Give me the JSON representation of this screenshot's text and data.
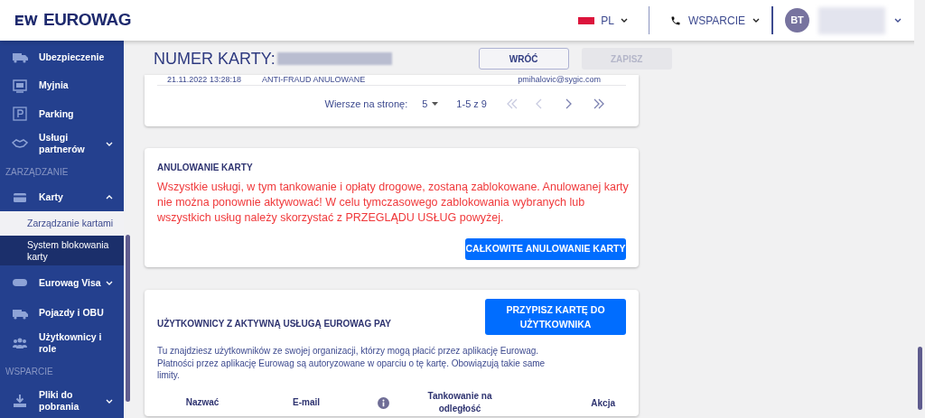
{
  "header": {
    "logo": "EUROWAG",
    "language": "PL",
    "support": "WSPARCIE",
    "avatar_initials": "BT"
  },
  "sidebar": {
    "items": [
      {
        "kind": "item",
        "label": "Ubezpieczenie"
      },
      {
        "kind": "item",
        "label": "Myjnia"
      },
      {
        "kind": "item",
        "label": "Parking"
      },
      {
        "kind": "group",
        "label": "Usługi partnerów",
        "expanded": false
      },
      {
        "kind": "section",
        "label": "ZARZĄDZANIE"
      },
      {
        "kind": "group",
        "label": "Karty",
        "expanded": true
      },
      {
        "kind": "sub",
        "label": "Zarządzanie kartami",
        "selected": false
      },
      {
        "kind": "sub",
        "label": "System blokowania karty",
        "selected": true
      },
      {
        "kind": "group",
        "label": "Eurowag Visa",
        "expanded": false
      },
      {
        "kind": "item",
        "label": "Pojazdy i OBU"
      },
      {
        "kind": "item",
        "label": "Użytkownicy i role"
      },
      {
        "kind": "section",
        "label": "WSPARCIE"
      },
      {
        "kind": "group",
        "label": "Pliki do pobrania",
        "expanded": false
      }
    ]
  },
  "page": {
    "title": "NUMER KARTY:",
    "buttons": [
      {
        "label": "WRÓĆ",
        "disabled": false
      },
      {
        "label": "ZAPISZ",
        "disabled": true
      }
    ]
  },
  "history_table": {
    "last_row": [
      "21.11.2022 13:28:18",
      "ANTI-FRAUD ANULOWANE",
      "pmihalovic@sygic.com"
    ],
    "pagination": {
      "rows_label": "Wiersze na stronę:",
      "rows_value": "5",
      "range": "1-5 z 9",
      "nav": [
        {
          "disabled": true
        },
        {
          "disabled": true
        },
        {
          "disabled": false
        },
        {
          "disabled": false
        }
      ]
    }
  },
  "cancel_card": {
    "title": "ANULOWANIE KARTY",
    "warning": "Wszystkie usługi, w tym tankowanie i opłaty drogowe, zostaną zablokowane. Anulowanej karty nie można ponownie aktywować! W celu tymczasowego zablokowania wybranych lub wszystkich usług należy skorzystać z PRZEGLĄDU USŁUG powyżej.",
    "button": "CAŁKOWITE ANULOWANIE KARTY"
  },
  "users_card": {
    "title": "UŻYTKOWNICY Z AKTYWNĄ USŁUGĄ EUROWAG PAY",
    "button": "PRZYPISZ KARTĘ DO UŻYTKOWNIKA",
    "description": "Tu znajdziesz użytkowników ze swojej organizacji, którzy mogą płacić przez aplikację Eurowag. Płatności przez aplikację Eurowag są autoryzowane w oparciu o tę kartę. Obowiązują takie same limity.",
    "columns": [
      {
        "kind": "text",
        "label": "Nazwać"
      },
      {
        "kind": "text",
        "label": "E-mail"
      },
      {
        "kind": "info"
      },
      {
        "kind": "text",
        "label": "Tankowanie na odległość"
      },
      {
        "kind": "text",
        "label": "Akcja"
      }
    ]
  }
}
